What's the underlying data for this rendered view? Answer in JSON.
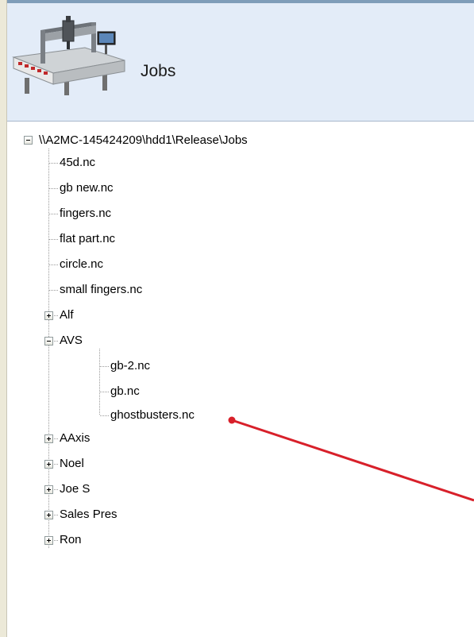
{
  "header": {
    "title": "Jobs",
    "image_icon": "cnc-router-machine-icon"
  },
  "tree": {
    "root": {
      "label": "\\\\A2MC-145424209\\hdd1\\Release\\Jobs",
      "expanded": true,
      "files": [
        {
          "label": "45d.nc"
        },
        {
          "label": "gb new.nc"
        },
        {
          "label": "fingers.nc"
        },
        {
          "label": "flat part.nc"
        },
        {
          "label": "circle.nc"
        },
        {
          "label": "small fingers.nc"
        }
      ],
      "folders": [
        {
          "label": "Alf",
          "expanded": false
        },
        {
          "label": "AVS",
          "expanded": true
        },
        {
          "label": "AAxis",
          "expanded": false
        },
        {
          "label": "Noel",
          "expanded": false
        },
        {
          "label": "Joe S",
          "expanded": false
        },
        {
          "label": "Sales Pres",
          "expanded": false
        },
        {
          "label": "Ron",
          "expanded": false
        }
      ],
      "avs_files": [
        {
          "label": "gb-2.nc"
        },
        {
          "label": "gb.nc"
        },
        {
          "label": "ghostbusters.nc"
        }
      ]
    }
  },
  "annotation": {
    "pointer_color": "#d8202a",
    "points_to": "ghostbusters.nc"
  }
}
